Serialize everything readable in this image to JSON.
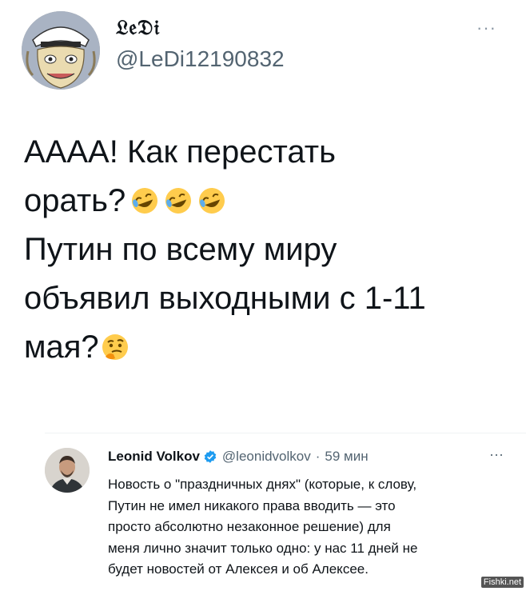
{
  "author": {
    "display_name": "𝔏𝔢𝔇𝔦",
    "handle": "@LeDi12190832",
    "more": "···",
    "avatar_icon": "cartoon-captain-avatar"
  },
  "tweet": {
    "lines": [
      "АААА! Как перестать",
      "орать?",
      "Путин по всему миру",
      "объявил выходными с 1-11",
      "мая?"
    ],
    "emoji_laugh": "rofl-emoji",
    "emoji_think": "thinking-emoji"
  },
  "quote": {
    "name": "Leonid Volkov",
    "handle": "@leonidvolkov",
    "dot": "·",
    "time": "59 мин",
    "more": "···",
    "verified_icon": "verified-badge-icon",
    "lines": [
      "Новость о \"праздничных днях\" (которые, к слову,",
      "Путин не имел никакого права вводить — это",
      "просто абсолютно незаконное решение) для",
      "меня лично значит только одно: у нас 11 дней не",
      "будет новостей от Алексея и об Алексее."
    ]
  },
  "watermark": "Fishki.net",
  "colors": {
    "text": "#0f1419",
    "secondary": "#536471",
    "verified": "#1d9bf0",
    "emoji": "#ffcc4d"
  }
}
